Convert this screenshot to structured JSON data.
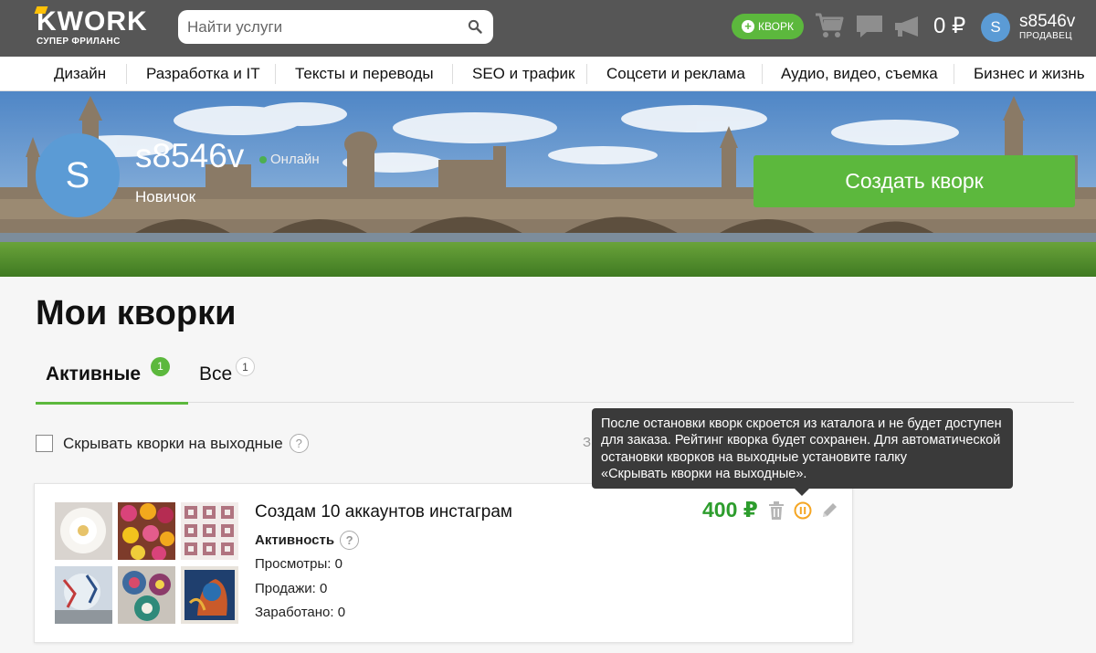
{
  "header": {
    "logo_text": "KWORK",
    "logo_tagline": "СУПЕР ФРИЛАНС",
    "search_placeholder": "Найти услуги",
    "add_kwork_label": "КВОРК",
    "balance": "0 ₽",
    "user_initial": "S",
    "username": "s8546v",
    "user_role": "ПРОДАВЕЦ"
  },
  "categories": [
    "Дизайн",
    "Разработка и IT",
    "Тексты и переводы",
    "SEO и трафик",
    "Соцсети и реклама",
    "Аудио, видео, съемка",
    "Бизнес и жизнь"
  ],
  "profile": {
    "initial": "S",
    "username": "s8546v",
    "status": "Онлайн",
    "level": "Новичок",
    "create_button": "Создать кворк"
  },
  "page": {
    "title": "Мои кворки",
    "tabs": [
      {
        "label": "Активные",
        "count": "1",
        "active": true
      },
      {
        "label": "Все",
        "count": "1",
        "active": false
      }
    ],
    "hide_weekend_label": "Скрывать кворки на выходные",
    "hidden_peek": "З",
    "help_glyph": "?"
  },
  "kwork": {
    "title": "Создам 10 аккаунтов инстаграм",
    "price": "400 ₽",
    "activity_label": "Активность",
    "views": "Просмотры: 0",
    "sales": "Продажи: 0",
    "earned": "Заработано: 0"
  },
  "tooltip": {
    "lines": [
      "После остановки кворк скроется из каталога и не будет доступен",
      "для заказа. Рейтинг кворка будет сохранен. Для автоматической",
      "остановки кворков на выходные установите галку",
      "«Скрывать кворки на выходные»."
    ]
  },
  "colors": {
    "header_bg": "#565656",
    "brand_green": "#5cb83d",
    "avatar_blue": "#5b9bd5",
    "price_green": "#2d9d2d",
    "pause_orange": "#f5a623",
    "tooltip_bg": "#3a3a3a"
  },
  "icons": {
    "search": "search-icon",
    "cart": "cart-icon",
    "messages": "message-icon",
    "notifications": "megaphone-icon",
    "delete": "trash-icon",
    "pause": "pause-icon",
    "edit": "pencil-icon"
  }
}
